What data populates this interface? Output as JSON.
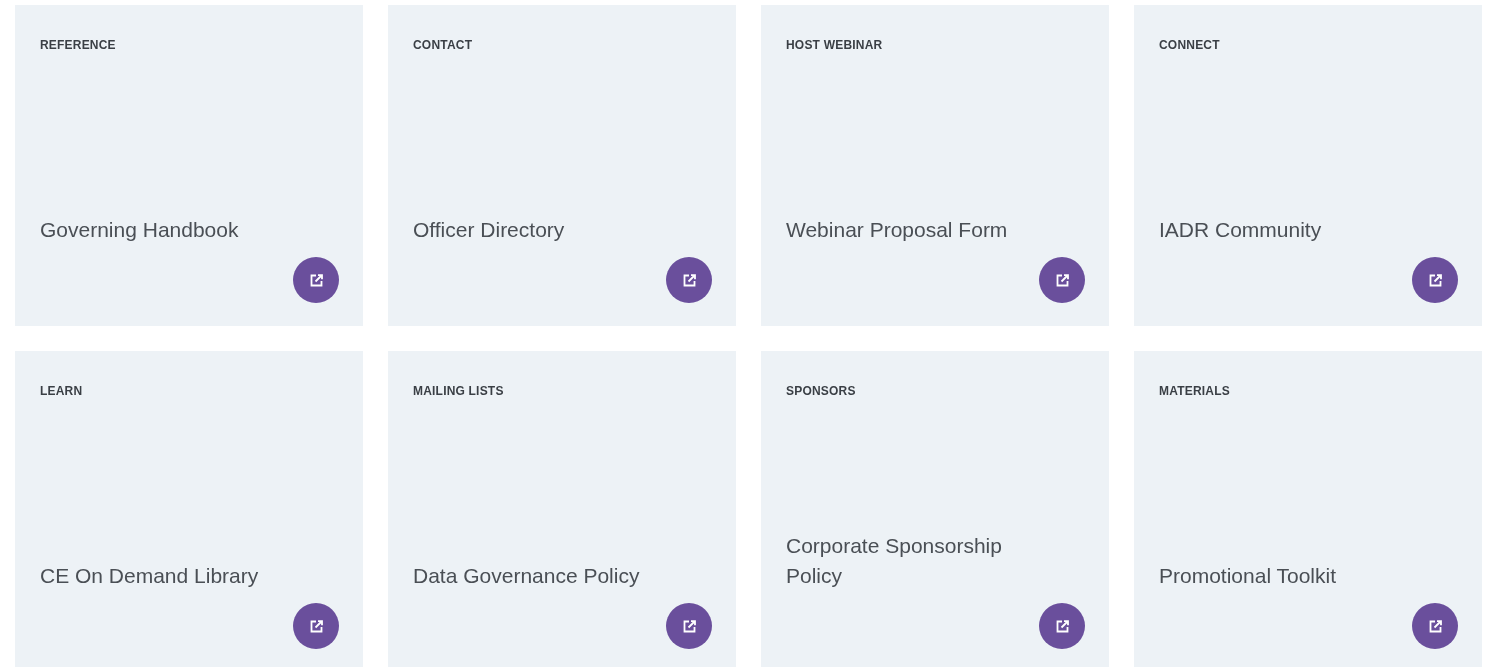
{
  "cards": [
    {
      "category": "REFERENCE",
      "title": "Governing Handbook"
    },
    {
      "category": "CONTACT",
      "title": "Officer Directory"
    },
    {
      "category": "HOST WEBINAR",
      "title": "Webinar Proposal Form"
    },
    {
      "category": "CONNECT",
      "title": "IADR Community"
    },
    {
      "category": "LEARN",
      "title": "CE On Demand Library"
    },
    {
      "category": "MAILING LISTS",
      "title": "Data Governance Policy"
    },
    {
      "category": "SPONSORS",
      "title": "Corporate Sponsorship Policy"
    },
    {
      "category": "MATERIALS",
      "title": "Promotional Toolkit"
    }
  ]
}
